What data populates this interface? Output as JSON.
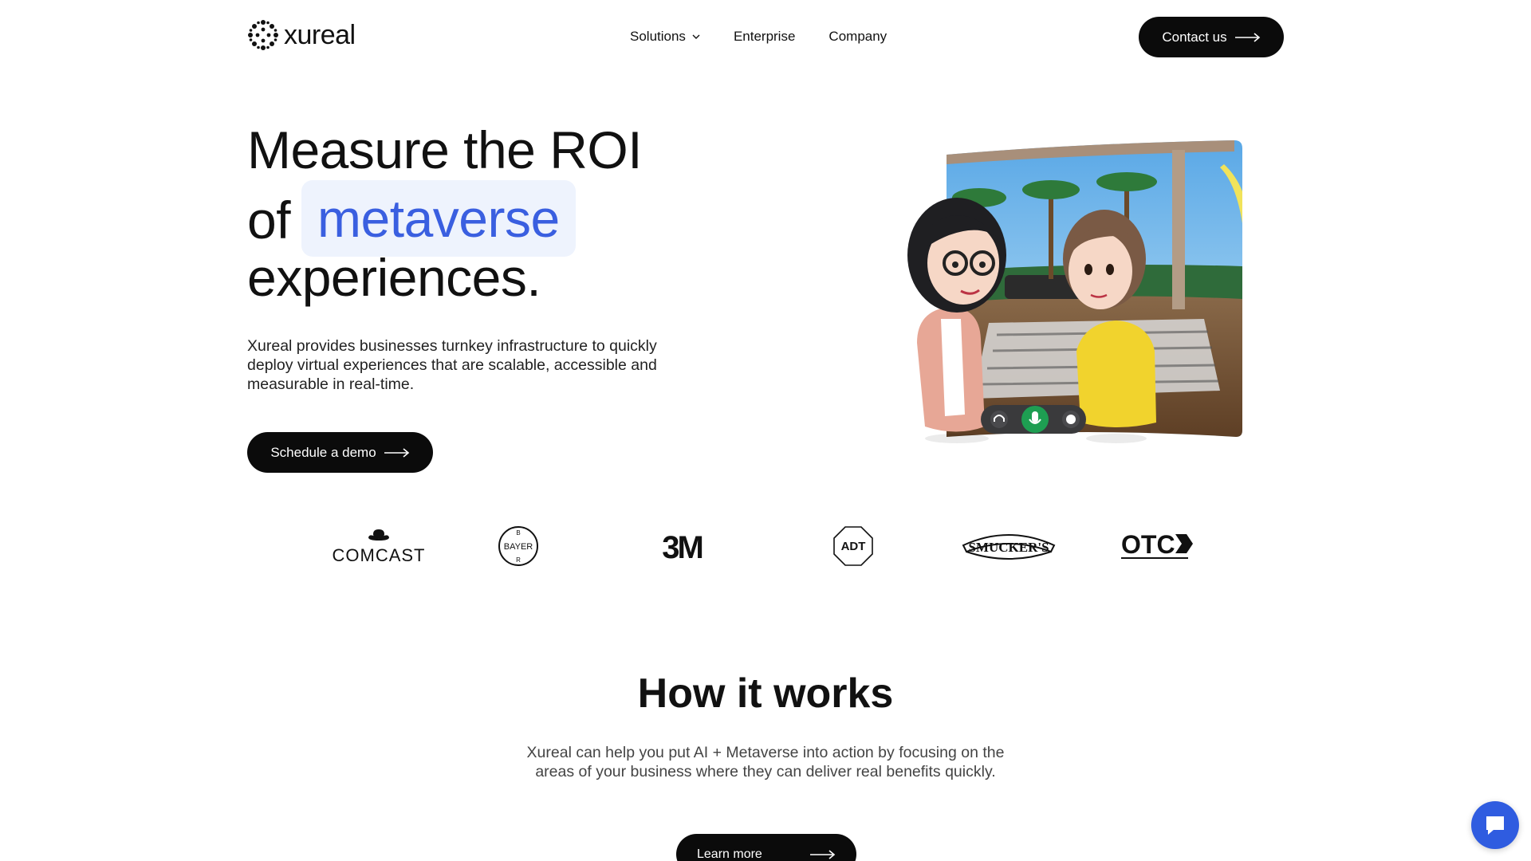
{
  "header": {
    "logo_text": "xureal",
    "nav": [
      {
        "label": "Solutions",
        "has_dropdown": true
      },
      {
        "label": "Enterprise"
      },
      {
        "label": "Company"
      }
    ],
    "contact_label": "Contact us"
  },
  "hero": {
    "title_line1": "Measure the ROI",
    "title_of": "of",
    "title_highlight": "metaverse",
    "title_line3": "experiences.",
    "description": "Xureal provides businesses turnkey infrastructure to quickly deploy virtual experiences that are scalable, accessible and measurable in real-time.",
    "cta_label": "Schedule a demo",
    "highlight_color": "#3a5fe0"
  },
  "clients": [
    {
      "name": "COMCAST"
    },
    {
      "name": "BAYER"
    },
    {
      "name": "3M"
    },
    {
      "name": "ADT"
    },
    {
      "name": "SMUCKER'S"
    },
    {
      "name": "OTC"
    }
  ],
  "how_it_works": {
    "title": "How it works",
    "description": "Xureal can help you put AI + Metaverse into action by focusing on the areas of your business where they can deliver real benefits quickly.",
    "cta_label": "Learn more"
  },
  "colors": {
    "button_bg": "#0b0b0b",
    "chat_bg": "#2f5ce0"
  },
  "icons": [
    "xureal-logo-icon",
    "chevron-down-icon",
    "arrow-right-icon",
    "headphones-icon",
    "microphone-icon",
    "emoji-icon",
    "chat-icon"
  ]
}
